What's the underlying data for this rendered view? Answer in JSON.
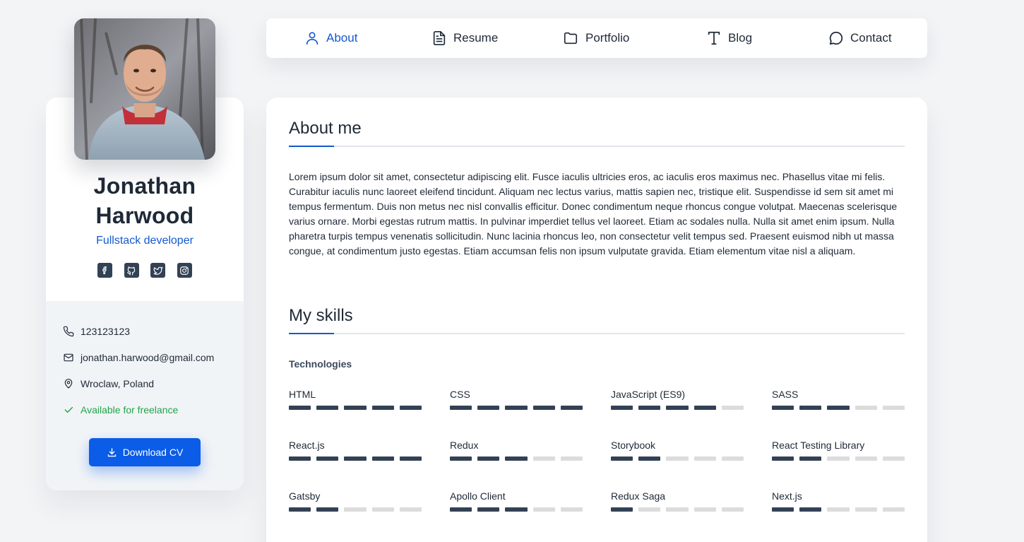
{
  "profile": {
    "name": "Jonathan Harwood",
    "role": "Fullstack developer",
    "socials": [
      {
        "icon": "facebook-icon"
      },
      {
        "icon": "github-icon"
      },
      {
        "icon": "twitter-icon"
      },
      {
        "icon": "instagram-icon"
      }
    ],
    "phone": "123123123",
    "email": "jonathan.harwood@gmail.com",
    "location": "Wroclaw, Poland",
    "availability": "Available for freelance",
    "download_label": "Download CV"
  },
  "nav": {
    "items": [
      {
        "label": "About",
        "icon": "user-icon",
        "active": true
      },
      {
        "label": "Resume",
        "icon": "document-icon",
        "active": false
      },
      {
        "label": "Portfolio",
        "icon": "folder-icon",
        "active": false
      },
      {
        "label": "Blog",
        "icon": "text-icon",
        "active": false
      },
      {
        "label": "Contact",
        "icon": "chat-bubble-icon",
        "active": false
      }
    ]
  },
  "about": {
    "title": "About me",
    "text": "Lorem ipsum dolor sit amet, consectetur adipiscing elit. Fusce iaculis ultricies eros, ac iaculis eros maximus nec. Phasellus vitae mi felis. Curabitur iaculis nunc laoreet eleifend tincidunt. Aliquam nec lectus varius, mattis sapien nec, tristique elit. Suspendisse id sem sit amet mi tempus fermentum. Duis non metus nec nisl convallis efficitur. Donec condimentum neque rhoncus congue volutpat. Maecenas scelerisque varius ornare. Morbi egestas rutrum mattis. In pulvinar imperdiet tellus vel laoreet. Etiam ac sodales nulla. Nulla sit amet enim ipsum. Nulla pharetra turpis tempus venenatis sollicitudin. Nunc lacinia rhoncus leo, non consectetur velit tempus sed. Praesent euismod nibh ut massa congue, at condimentum justo egestas. Etiam accumsan felis non ipsum vulputate gravida. Etiam elementum vitae nisl a aliquam."
  },
  "skills": {
    "title": "My skills",
    "group": "Technologies",
    "max_level": 5,
    "items": [
      {
        "name": "HTML",
        "level": 5
      },
      {
        "name": "CSS",
        "level": 5
      },
      {
        "name": "JavaScript (ES9)",
        "level": 4
      },
      {
        "name": "SASS",
        "level": 3
      },
      {
        "name": "React.js",
        "level": 5
      },
      {
        "name": "Redux",
        "level": 3
      },
      {
        "name": "Storybook",
        "level": 2
      },
      {
        "name": "React Testing Library",
        "level": 2
      },
      {
        "name": "Gatsby",
        "level": 2
      },
      {
        "name": "Apollo Client",
        "level": 3
      },
      {
        "name": "Redux Saga",
        "level": 1
      },
      {
        "name": "Next.js",
        "level": 2
      }
    ]
  },
  "colors": {
    "accent": "#1259d1",
    "button": "#0b5ce6",
    "available": "#22a348",
    "skill_on": "#334155",
    "skill_off": "#dcdcdc"
  }
}
